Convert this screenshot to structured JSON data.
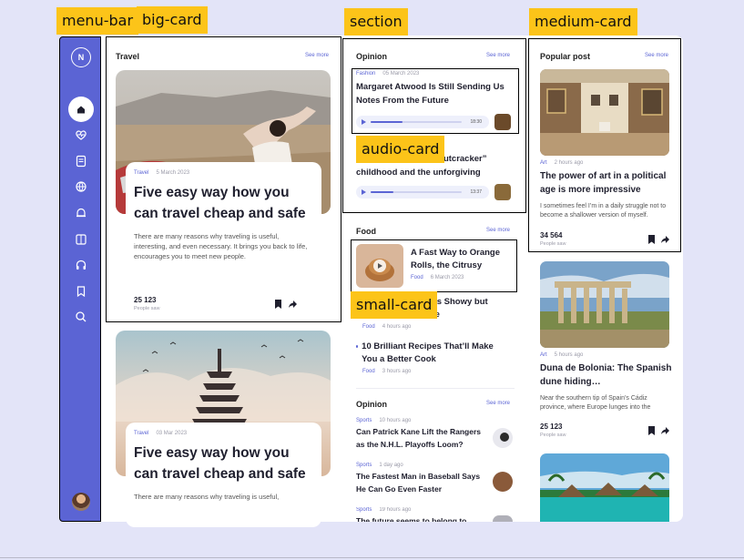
{
  "annotations": {
    "menu_bar": "menu-bar",
    "big_card": "big-card",
    "section": "section",
    "medium_card": "medium-card",
    "audio_card": "audio-card",
    "small_card": "small-card"
  },
  "menu": {
    "logo_letter": "N",
    "icons": [
      "home-icon",
      "heart-pulse-icon",
      "document-icon",
      "globe-icon",
      "bell-icon",
      "book-icon",
      "headphones-icon",
      "bookmark-icon",
      "search-icon"
    ]
  },
  "travel": {
    "title": "Travel",
    "see_more": "See more",
    "cards": [
      {
        "category": "Travel",
        "date": "5 March 2023",
        "headline": "Five easy way how you can travel cheap and safe",
        "excerpt": "There are many reasons why traveling is useful, interesting, and even necessary. It brings you back to life, encourages you to meet new people.",
        "count": "25 123",
        "count_label": "People saw"
      },
      {
        "category": "Travel",
        "date": "03 Mar 2023",
        "headline": "Five easy way how you can travel cheap and safe",
        "excerpt": "There are many reasons why traveling is useful,"
      }
    ]
  },
  "opinion": {
    "title": "Opinion",
    "see_more": "See more",
    "audio": [
      {
        "category": "Fashion",
        "date": "05 March 2023",
        "headline": "Margaret Atwood Is Still Sending Us Notes From the Future",
        "time": "18:30",
        "progress": 0.35
      },
      {
        "headline_partial": "r “Nutcracker” childhood and the unforgiving",
        "time": "13:37",
        "progress": 0.25
      }
    ]
  },
  "food": {
    "title": "Food",
    "see_more": "See more",
    "small_card": {
      "headline": "A Fast Way to Orange Rolls, the Citrusy",
      "category": "Food",
      "date": "6 March 2023"
    },
    "partial_line1": "m Is Showy but",
    "partial_line2": "btle",
    "partial_meta_cat": "Food",
    "partial_meta_time": "4 hours ago",
    "item": {
      "headline": "10 Brilliant Recipes That’ll Make You a Better Cook",
      "category": "Food",
      "time": "3 hours ago"
    }
  },
  "opinion2": {
    "title": "Opinion",
    "see_more": "See more",
    "items": [
      {
        "category": "Sports",
        "time": "10 hours ago",
        "headline": "Can Patrick Kane Lift the Rangers as the N.H.L. Playoffs Loom?"
      },
      {
        "category": "Sports",
        "time": "1 day ago",
        "headline": "The Fastest Man in Baseball Says He Can Go Even Faster"
      },
      {
        "category": "Sports",
        "time": "19 hours ago",
        "headline": "The future seems to belong to"
      }
    ]
  },
  "popular": {
    "title": "Popular post",
    "see_more": "See more",
    "posts": [
      {
        "category": "Art",
        "time": "2 hours ago",
        "headline": "The power of art in a political age is more impressive",
        "excerpt": "I sometimes feel I’m in a daily struggle not to become a shallower version of myself.",
        "count": "34 564",
        "count_label": "People saw"
      },
      {
        "category": "Art",
        "time": "5 hours ago",
        "headline": "Duna de Bolonia: The Spanish dune hiding…",
        "excerpt": "Near the southern tip of Spain’s Cádiz province, where Europe lunges into the",
        "count": "25 123",
        "count_label": "People saw"
      }
    ]
  },
  "colors": {
    "accent": "#5b64d4",
    "tag": "#fcc419",
    "background": "#e3e4f8"
  }
}
